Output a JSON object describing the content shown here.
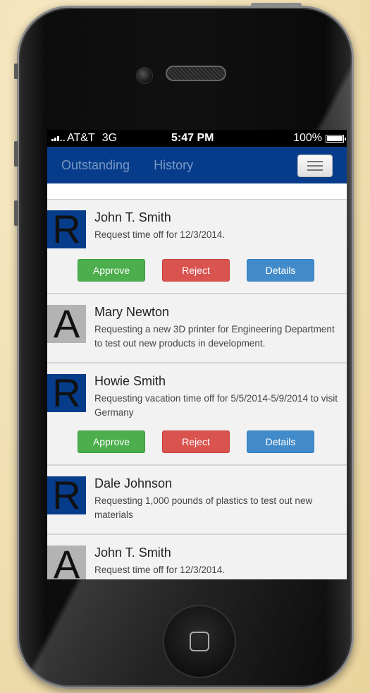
{
  "status_bar": {
    "carrier": "AT&T",
    "network": "3G",
    "time": "5:47 PM",
    "battery": "100%"
  },
  "nav": {
    "tabs": [
      "Outstanding",
      "History"
    ],
    "menu_icon": "hamburger-menu-icon"
  },
  "buttons": {
    "approve": "Approve",
    "reject": "Reject",
    "details": "Details"
  },
  "requests": [
    {
      "letter": "R",
      "name": "John T. Smith",
      "description": "Request time off for 12/3/2014.",
      "has_actions": true
    },
    {
      "letter": "A",
      "name": "Mary Newton",
      "description": "Requesting a new 3D printer for Engineering Department to test out new products in development.",
      "has_actions": false
    },
    {
      "letter": "R",
      "name": "Howie Smith",
      "description": "Requesting vacation time off for 5/5/2014-5/9/2014 to visit Germany",
      "has_actions": true
    },
    {
      "letter": "R",
      "name": "Dale Johnson",
      "description": "Requesting 1,000 pounds of plastics to test out new materials",
      "has_actions": false
    },
    {
      "letter": "A",
      "name": "John T. Smith",
      "description": "Request time off for 12/3/2014.",
      "has_actions": false
    }
  ],
  "colors": {
    "navbar": "#063c8a",
    "approve": "#4cae4c",
    "reject": "#d9534f",
    "details": "#428bca",
    "letter_r_bg": "#063c8a",
    "letter_a_bg": "#b3b3b3"
  }
}
